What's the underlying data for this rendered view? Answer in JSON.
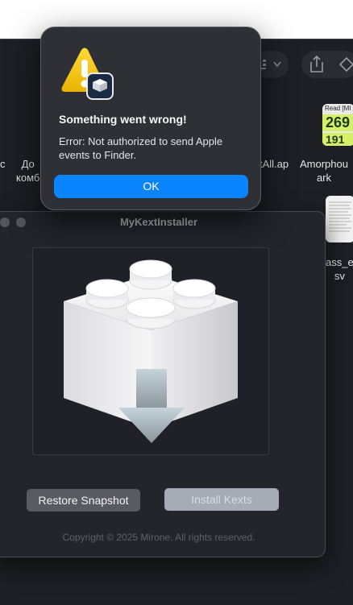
{
  "finder": {
    "files": [
      {
        "label": "с"
      },
      {
        "label": "До\nкомб"
      },
      {
        "label": "tAll.ap"
      },
      {
        "label": "Amorphou\nark"
      },
      {
        "label": "ass_e\nsv"
      }
    ],
    "thumbs": [
      {
        "line1": "Read [MI",
        "line2": "269",
        "line3": "191"
      }
    ]
  },
  "kext_window": {
    "title": "MyKextInstaller",
    "icon": "kext-lego-brick-download-icon",
    "restore_label": "Restore Snapshot",
    "install_label": "Install Kexts",
    "copyright": "Copyright © 2025 Mirone. All rights reserved."
  },
  "alert": {
    "icon": "warning-triangle-icon",
    "badge_icon": "app-badge-icon",
    "title": "Something went wrong!",
    "message": "Error: Not authorized to send Apple events to Finder.",
    "ok_label": "OK"
  },
  "colors": {
    "accent": "#0a84ff",
    "warning": "#f5c400"
  }
}
